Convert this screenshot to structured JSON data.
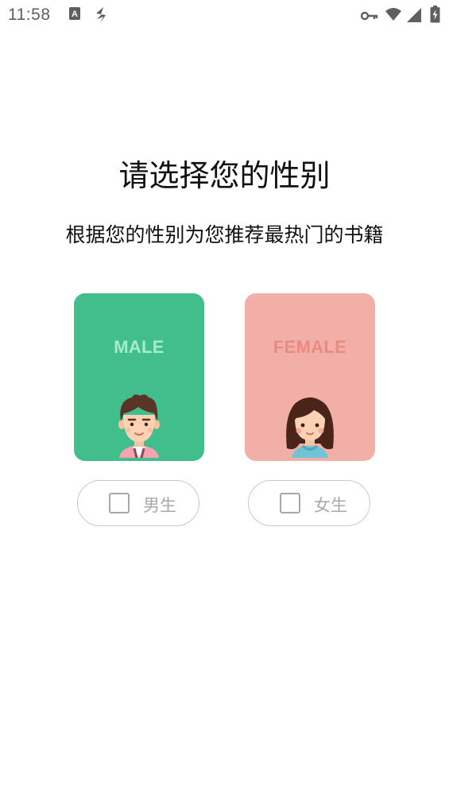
{
  "status_bar": {
    "time": "11:58",
    "left_icons": [
      "a-keyboard-icon",
      "signal-bolt-icon"
    ],
    "right_icons": [
      "vpn-key-icon",
      "wifi-icon",
      "cell-signal-icon",
      "battery-charging-icon"
    ]
  },
  "page": {
    "title": "请选择您的性别",
    "subtitle": "根据您的性别为您推荐最热门的书籍"
  },
  "cards": {
    "male": {
      "label": "MALE",
      "color": "#41be8b"
    },
    "female": {
      "label": "FEMALE",
      "color": "#f1afa8"
    }
  },
  "options": {
    "male": {
      "label": "男生",
      "checked": false
    },
    "female": {
      "label": "女生",
      "checked": false
    }
  }
}
